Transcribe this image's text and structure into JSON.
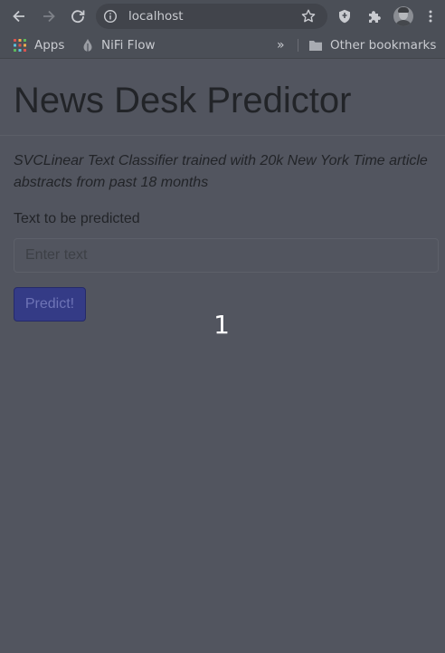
{
  "browser": {
    "url": "localhost",
    "bookmarks": [
      {
        "label": "Apps",
        "icon": "apps-grid-icon"
      },
      {
        "label": "NiFi Flow",
        "icon": "nifi-drop-icon"
      }
    ],
    "overflow_label": "»",
    "other_bookmarks_label": "Other bookmarks",
    "icons": [
      "back-arrow-icon",
      "forward-arrow-icon",
      "reload-icon",
      "info-icon",
      "star-icon",
      "shield-extension-icon",
      "puzzle-extension-icon",
      "profile-avatar",
      "folder-icon"
    ]
  },
  "page": {
    "title": "News Desk Predictor",
    "description": "SVCLinear Text Classifier trained with 20k New York Time article abstracts from past 18 months",
    "input_label": "Text to be predicted",
    "input_placeholder": "Enter text",
    "input_value": "",
    "predict_button_label": "Predict!",
    "overlay_number": "1"
  },
  "colors": {
    "background": "#52555f",
    "toolbar": "#4b4f57",
    "button": "#343b86",
    "text": "#222428",
    "overlay_text": "#ffffff"
  }
}
